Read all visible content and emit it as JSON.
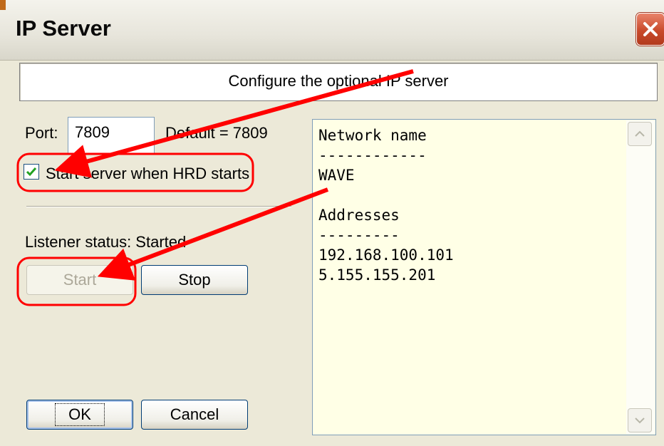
{
  "window": {
    "title": "IP Server"
  },
  "header": {
    "text": "Configure the optional IP server"
  },
  "port": {
    "label": "Port:",
    "value": "7809",
    "default_text": "Default = 7809"
  },
  "autostart": {
    "label": "Start server when HRD starts",
    "checked": true
  },
  "listener": {
    "status_text": "Listener status: Started"
  },
  "buttons": {
    "start": "Start",
    "stop": "Stop",
    "ok": "OK",
    "cancel": "Cancel"
  },
  "info": {
    "lines": [
      "Network name",
      "------------",
      "WAVE",
      "",
      "Addresses",
      "---------",
      "192.168.100.101",
      "5.155.155.201"
    ]
  },
  "icons": {
    "close": "close-icon",
    "checkbox": "checkmark-icon",
    "scroll_up": "scroll-up-icon",
    "scroll_down": "scroll-down-icon"
  },
  "colors": {
    "annotation": "#ff0000",
    "close_button": "#c94a2b",
    "info_background": "#ffffe6"
  }
}
